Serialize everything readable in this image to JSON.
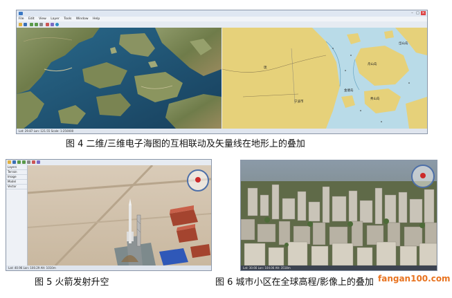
{
  "figure4": {
    "window_title": "",
    "menu": [
      "File",
      "Edit",
      "View",
      "Layer",
      "Tools",
      "Window",
      "Help"
    ],
    "map_labels": {
      "river": "琉",
      "city": "宁波市",
      "island_a": "舟山岛",
      "island_b": "岱山岛",
      "island_c": "秀山岛",
      "island_d": "金塘岛"
    },
    "status_text": "Lat: 29.87  Lon: 121.55  Scale: 1:250000",
    "caption": "图 4  二维/三维电子海图的互相联动及矢量线在地形上的叠加"
  },
  "figure5": {
    "side_panel_items": [
      "Layers",
      "Terrain",
      "Image",
      "Model",
      "Vector"
    ],
    "status_text": "Lat: 40.96  Lon: 100.29  Alt: 1010m",
    "caption": "图 5  火箭发射升空"
  },
  "figure6": {
    "status_text": "Lat: 30.66  Lon: 104.06  Alt: 3518m",
    "caption_main": "图 6   城市小区在全球高程/影像上的",
    "caption_tail": "叠加",
    "watermark": "fangan100.com"
  },
  "colors": {
    "sea_2d": "#b9dbe8",
    "land_2d": "#e6d17a",
    "sea_3d": "#1f4f72",
    "watermark": "#e8731f"
  }
}
